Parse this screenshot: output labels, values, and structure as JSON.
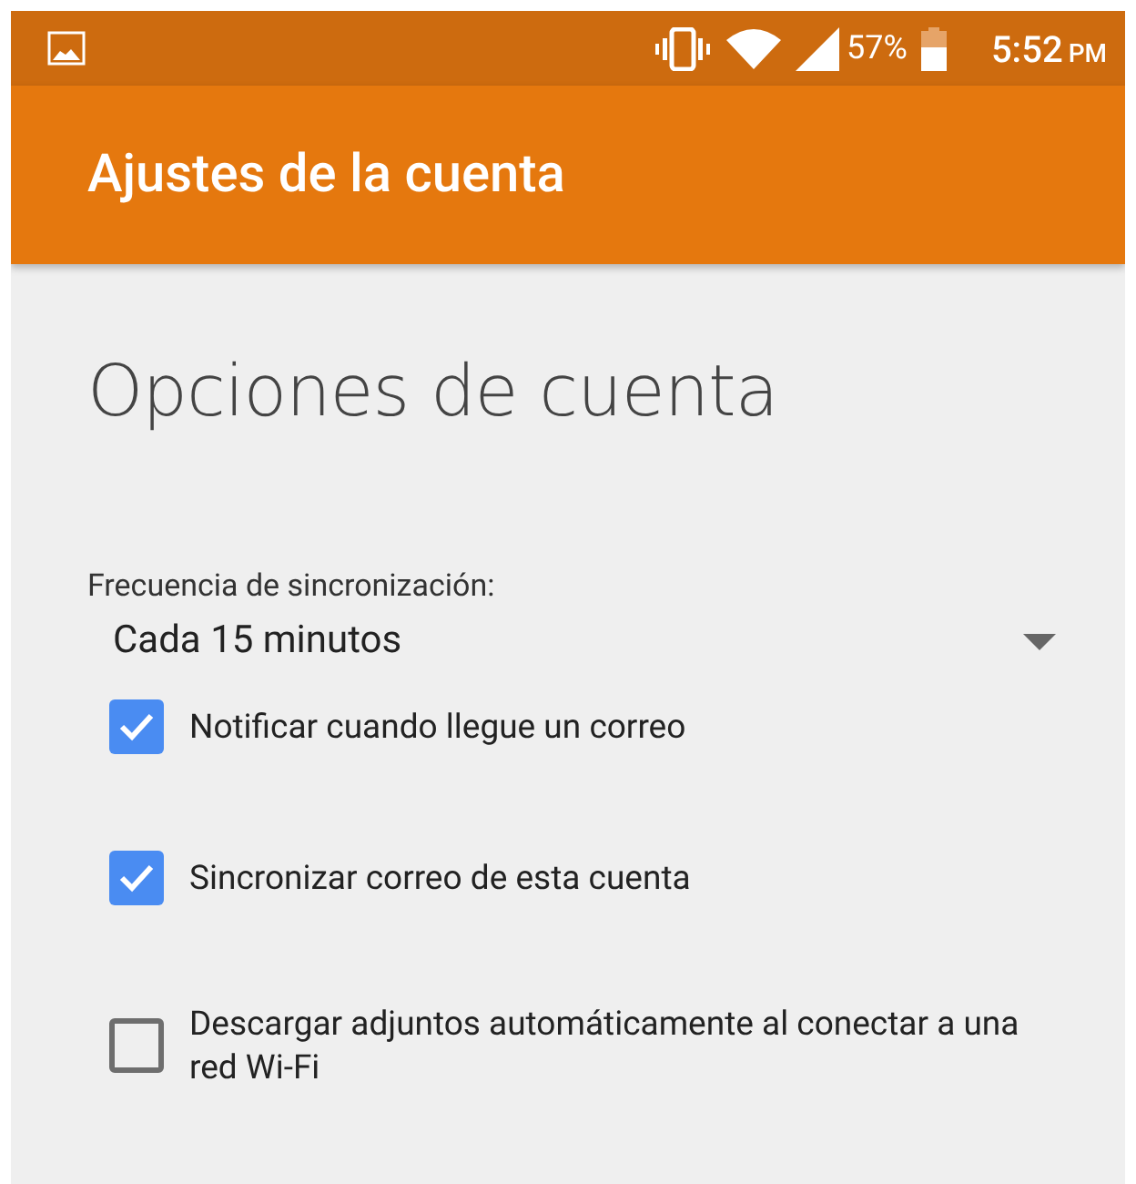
{
  "status_bar": {
    "battery": "57%",
    "time": "5:52",
    "time_suffix": "PM"
  },
  "app_bar": {
    "title": "Ajustes de la cuenta"
  },
  "section": {
    "heading": "Opciones de cuenta"
  },
  "sync_frequency": {
    "label": "Frecuencia de sincronización:",
    "value": "Cada 15 minutos"
  },
  "options": [
    {
      "label": "Notificar cuando llegue un correo",
      "checked": true
    },
    {
      "label": "Sincronizar correo de esta cuenta",
      "checked": true
    },
    {
      "label": "Descargar adjuntos automáticamente al conectar a una red Wi-Fi",
      "checked": false
    }
  ]
}
